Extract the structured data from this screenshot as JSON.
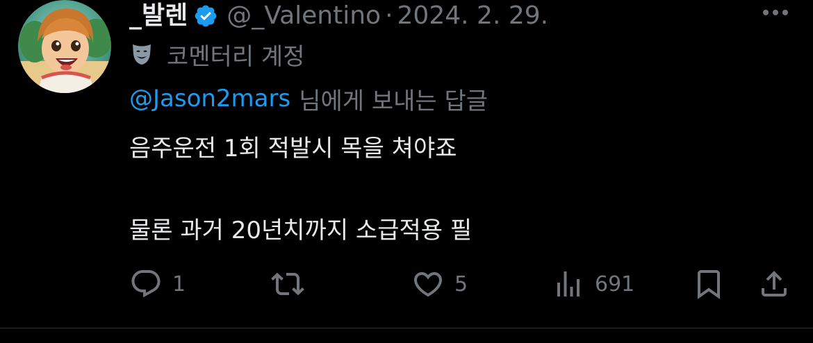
{
  "tweet": {
    "display_name": "_발렌",
    "handle": "@_Valentino",
    "separator": "·",
    "date": "2024. 2. 29.",
    "account_label": "코멘터리 계정",
    "reply_to_mention": "@Jason2mars",
    "reply_suffix": "님에게 보내는 답글",
    "body_line_1": "음주운전 1회 적발시 목을 쳐야죠",
    "body_line_2": "물론 과거 20년치까지 소급적용 필"
  },
  "actions": {
    "reply_count": "1",
    "retweet_count": "",
    "like_count": "5",
    "views_count": "691"
  },
  "colors": {
    "background": "#000000",
    "primary_text": "#e7e9ea",
    "secondary_text": "#71767b",
    "accent_blue": "#1d9bf0",
    "divider": "#2f3336"
  },
  "icons": {
    "verified": "verified-badge-icon",
    "more": "more-horizontal-icon",
    "mask": "theater-mask-icon",
    "reply": "reply-bubble-icon",
    "retweet": "retweet-icon",
    "like": "heart-icon",
    "views": "views-chart-icon",
    "bookmark": "bookmark-icon",
    "share": "share-icon"
  }
}
